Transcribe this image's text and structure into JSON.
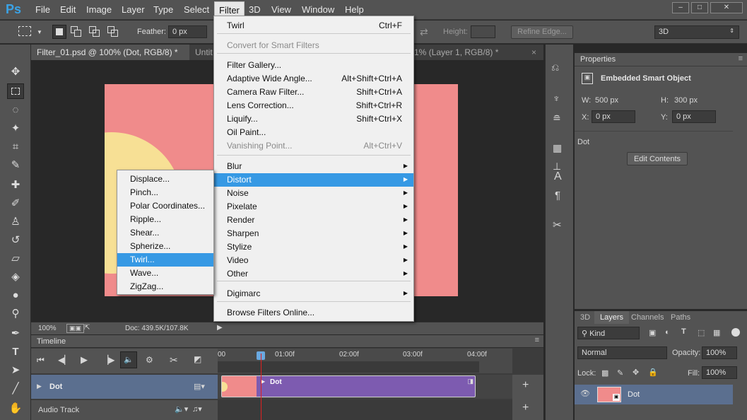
{
  "app": {
    "logo": "Ps"
  },
  "menubar": {
    "items": [
      "File",
      "Edit",
      "Image",
      "Layer",
      "Type",
      "Select",
      "Filter",
      "3D",
      "View",
      "Window",
      "Help"
    ],
    "window_controls": [
      "–",
      "□",
      "✕"
    ]
  },
  "options": {
    "feather_label": "Feather:",
    "feather_value": "0 px",
    "height_label": "Height:",
    "refine_edge": "Refine Edge...",
    "workspace": "3D"
  },
  "tabs": [
    {
      "label": "Filter_01.psd @ 100% (Dot, RGB/8) *",
      "close": "×"
    },
    {
      "label": "Untit",
      "close": ""
    },
    {
      "label": "1% (Layer 1, RGB/8) *",
      "close": "×"
    }
  ],
  "status": {
    "zoom": "100%",
    "doc": "Doc: 439.5K/107.8K"
  },
  "timeline": {
    "title": "Timeline",
    "ticks": [
      "00",
      "01:00f",
      "02:00f",
      "03:00f",
      "04:00f"
    ],
    "track_name": "Dot",
    "clip_name": "Dot",
    "audio_track": "Audio Track",
    "add": "+"
  },
  "properties": {
    "title": "Properties",
    "type": "Embedded Smart Object",
    "w_label": "W:",
    "w_value": "500 px",
    "h_label": "H:",
    "h_value": "300 px",
    "x_label": "X:",
    "x_value": "0 px",
    "y_label": "Y:",
    "y_value": "0 px",
    "layer_name": "Dot",
    "edit_contents": "Edit Contents"
  },
  "layers_panel": {
    "tabs": [
      "3D",
      "Layers",
      "Channels",
      "Paths"
    ],
    "kind": "Kind",
    "blend": "Normal",
    "opacity_label": "Opacity:",
    "opacity_value": "100%",
    "lock_label": "Lock:",
    "fill_label": "Fill:",
    "fill_value": "100%",
    "layer_name": "Dot"
  },
  "filter_menu": {
    "items": [
      {
        "label": "Twirl",
        "shortcut": "Ctrl+F"
      },
      {
        "label": "Convert for Smart Filters",
        "shortcut": "",
        "disabled": true
      },
      {
        "label": "Filter Gallery...",
        "shortcut": ""
      },
      {
        "label": "Adaptive Wide Angle...",
        "shortcut": "Alt+Shift+Ctrl+A"
      },
      {
        "label": "Camera Raw Filter...",
        "shortcut": "Shift+Ctrl+A"
      },
      {
        "label": "Lens Correction...",
        "shortcut": "Shift+Ctrl+R"
      },
      {
        "label": "Liquify...",
        "shortcut": "Shift+Ctrl+X"
      },
      {
        "label": "Oil Paint...",
        "shortcut": ""
      },
      {
        "label": "Vanishing Point...",
        "shortcut": "Alt+Ctrl+V",
        "disabled": true
      },
      {
        "label": "Blur",
        "submenu": true
      },
      {
        "label": "Distort",
        "submenu": true,
        "highlight": true
      },
      {
        "label": "Noise",
        "submenu": true
      },
      {
        "label": "Pixelate",
        "submenu": true
      },
      {
        "label": "Render",
        "submenu": true
      },
      {
        "label": "Sharpen",
        "submenu": true
      },
      {
        "label": "Stylize",
        "submenu": true
      },
      {
        "label": "Video",
        "submenu": true
      },
      {
        "label": "Other",
        "submenu": true
      },
      {
        "label": "Digimarc",
        "submenu": true
      },
      {
        "label": "Browse Filters Online..."
      }
    ]
  },
  "distort_menu": {
    "items": [
      "Displace...",
      "Pinch...",
      "Polar Coordinates...",
      "Ripple...",
      "Shear...",
      "Spherize...",
      "Twirl...",
      "Wave...",
      "ZigZag..."
    ],
    "highlight_index": 6
  },
  "colors": {
    "accent": "#3699e4",
    "doc_bg": "#f08b8b",
    "sun": "#f7e095",
    "clip": "#7d5bb0"
  }
}
